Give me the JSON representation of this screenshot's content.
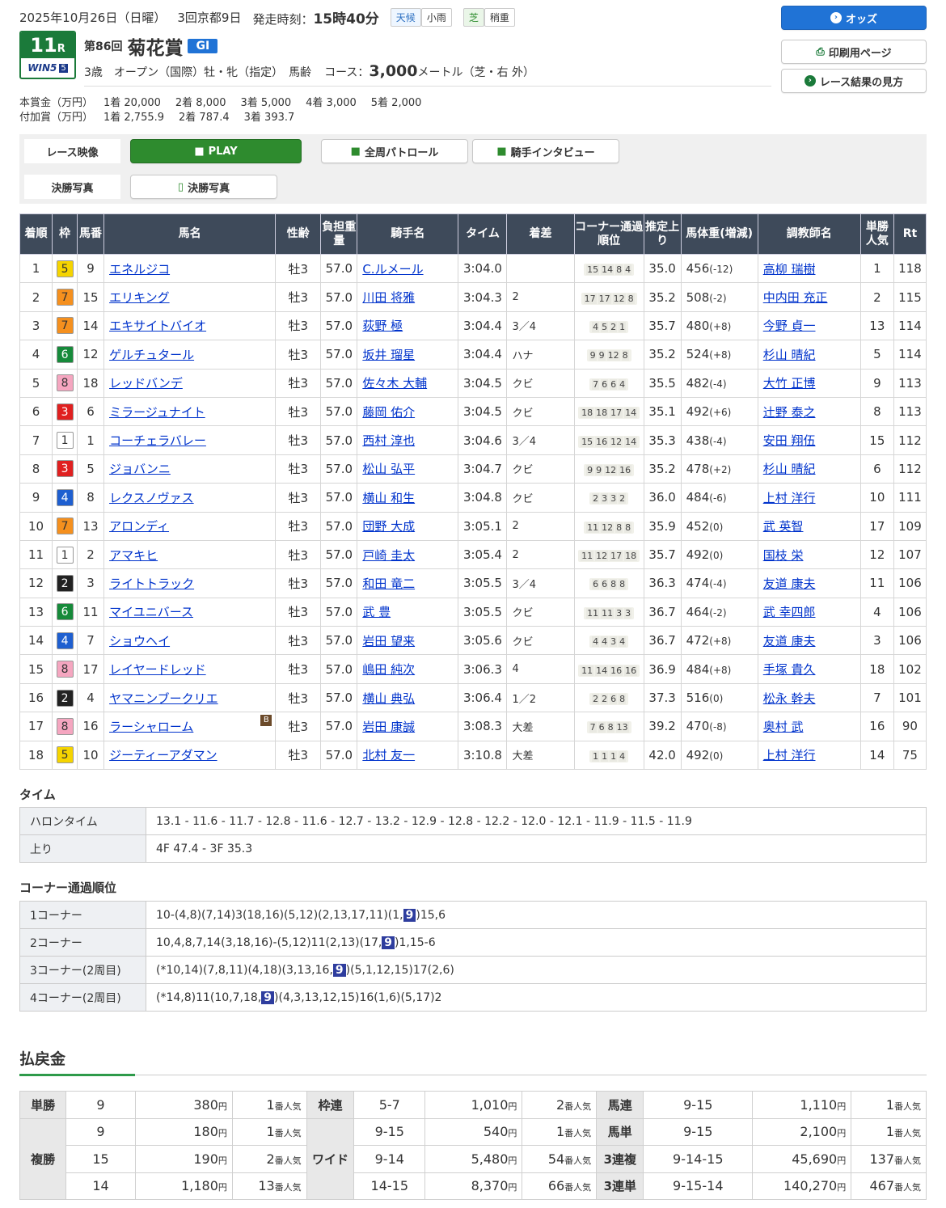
{
  "header": {
    "date": "2025年10月26日（日曜）",
    "kaisai": "3回京都9日",
    "start_label": "発走時刻：",
    "start_time": "15時40分",
    "weather_label": "天候",
    "weather": "小雨",
    "track_label": "芝",
    "track": "稍重",
    "race_no": "11",
    "race_suffix": "R",
    "win5": "WIN5",
    "win5_no": "5",
    "kai": "第86回",
    "race_name": "菊花賞",
    "grade": "GI",
    "conditions": "3歳　オープン（国際）牡・牝（指定）　馬齢",
    "course_label": "コース：",
    "distance": "3,000",
    "course_unit": "メートル（芝・右 外）",
    "prize_label": "本賞金（万円）",
    "prize": [
      "1着 20,000",
      "2着  8,000",
      "3着  5,000",
      "4着  3,000",
      "5着  2,000"
    ],
    "addprize_label": "付加賞（万円）",
    "addprize": [
      "1着 2,755.9",
      "2着  787.4",
      "3着  393.7"
    ]
  },
  "side_buttons": {
    "odds": "オッズ",
    "print": "印刷用ページ",
    "guide": "レース結果の見方"
  },
  "video": {
    "race_label": "レース映像",
    "play": "PLAY",
    "patrol": "全周パトロール",
    "interview": "騎手インタビュー",
    "photo_label": "決勝写真",
    "photo": "決勝写真"
  },
  "columns": [
    "着順",
    "枠",
    "馬番",
    "馬名",
    "性齢",
    "負担重量",
    "騎手名",
    "タイム",
    "着差",
    "コーナー通過順位",
    "推定上り",
    "馬体重(増減)",
    "調教師名",
    "単勝人気",
    "Rt"
  ],
  "waku_colors": {
    "1": [
      "#ffffff",
      "#333"
    ],
    "2": [
      "#222222",
      "#fff"
    ],
    "3": [
      "#e02020",
      "#fff"
    ],
    "4": [
      "#1e5fd0",
      "#fff"
    ],
    "5": [
      "#f5d400",
      "#333"
    ],
    "6": [
      "#168a3a",
      "#fff"
    ],
    "7": [
      "#f5901e",
      "#333"
    ],
    "8": [
      "#f5a6c0",
      "#333"
    ]
  },
  "results": [
    [
      "1",
      "5",
      "9",
      "エネルジコ",
      "牡3",
      "57.0",
      "C.ルメール",
      "3:04.0",
      "",
      [
        "15",
        "14",
        "8",
        "4"
      ],
      "35.0",
      "456",
      "(-12)",
      "高柳 瑞樹",
      "1",
      "118",
      ""
    ],
    [
      "2",
      "7",
      "15",
      "エリキング",
      "牡3",
      "57.0",
      "川田 将雅",
      "3:04.3",
      "2",
      [
        "17",
        "17",
        "12",
        "8"
      ],
      "35.2",
      "508",
      "(-2)",
      "中内田 充正",
      "2",
      "115",
      ""
    ],
    [
      "3",
      "7",
      "14",
      "エキサイトバイオ",
      "牡3",
      "57.0",
      "荻野 極",
      "3:04.4",
      "3／4",
      [
        "4",
        "5",
        "2",
        "1"
      ],
      "35.7",
      "480",
      "(+8)",
      "今野 貞一",
      "13",
      "114",
      ""
    ],
    [
      "4",
      "6",
      "12",
      "ゲルチュタール",
      "牡3",
      "57.0",
      "坂井 瑠星",
      "3:04.4",
      "ハナ",
      [
        "9",
        "9",
        "12",
        "8"
      ],
      "35.2",
      "524",
      "(+8)",
      "杉山 晴紀",
      "5",
      "114",
      ""
    ],
    [
      "5",
      "8",
      "18",
      "レッドバンデ",
      "牡3",
      "57.0",
      "佐々木 大輔",
      "3:04.5",
      "クビ",
      [
        "7",
        "6",
        "6",
        "4"
      ],
      "35.5",
      "482",
      "(-4)",
      "大竹 正博",
      "9",
      "113",
      ""
    ],
    [
      "6",
      "3",
      "6",
      "ミラージュナイト",
      "牡3",
      "57.0",
      "藤岡 佑介",
      "3:04.5",
      "クビ",
      [
        "18",
        "18",
        "17",
        "14"
      ],
      "35.1",
      "492",
      "(+6)",
      "辻野 泰之",
      "8",
      "113",
      ""
    ],
    [
      "7",
      "1",
      "1",
      "コーチェラバレー",
      "牡3",
      "57.0",
      "西村 淳也",
      "3:04.6",
      "3／4",
      [
        "15",
        "16",
        "12",
        "14"
      ],
      "35.3",
      "438",
      "(-4)",
      "安田 翔伍",
      "15",
      "112",
      ""
    ],
    [
      "8",
      "3",
      "5",
      "ジョバンニ",
      "牡3",
      "57.0",
      "松山 弘平",
      "3:04.7",
      "クビ",
      [
        "9",
        "9",
        "12",
        "16"
      ],
      "35.2",
      "478",
      "(+2)",
      "杉山 晴紀",
      "6",
      "112",
      ""
    ],
    [
      "9",
      "4",
      "8",
      "レクスノヴァス",
      "牡3",
      "57.0",
      "横山 和生",
      "3:04.8",
      "クビ",
      [
        "2",
        "3",
        "3",
        "2"
      ],
      "36.0",
      "484",
      "(-6)",
      "上村 洋行",
      "10",
      "111",
      ""
    ],
    [
      "10",
      "7",
      "13",
      "アロンディ",
      "牡3",
      "57.0",
      "団野 大成",
      "3:05.1",
      "2",
      [
        "11",
        "12",
        "8",
        "8"
      ],
      "35.9",
      "452",
      "(0)",
      "武 英智",
      "17",
      "109",
      ""
    ],
    [
      "11",
      "1",
      "2",
      "アマキヒ",
      "牡3",
      "57.0",
      "戸崎 圭太",
      "3:05.4",
      "2",
      [
        "11",
        "12",
        "17",
        "18"
      ],
      "35.7",
      "492",
      "(0)",
      "国枝 栄",
      "12",
      "107",
      ""
    ],
    [
      "12",
      "2",
      "3",
      "ライトトラック",
      "牡3",
      "57.0",
      "和田 竜二",
      "3:05.5",
      "3／4",
      [
        "6",
        "6",
        "8",
        "8"
      ],
      "36.3",
      "474",
      "(-4)",
      "友道 康夫",
      "11",
      "106",
      ""
    ],
    [
      "13",
      "6",
      "11",
      "マイユニバース",
      "牡3",
      "57.0",
      "武 豊",
      "3:05.5",
      "クビ",
      [
        "11",
        "11",
        "3",
        "3"
      ],
      "36.7",
      "464",
      "(-2)",
      "武 幸四郎",
      "4",
      "106",
      ""
    ],
    [
      "14",
      "4",
      "7",
      "ショウヘイ",
      "牡3",
      "57.0",
      "岩田 望来",
      "3:05.6",
      "クビ",
      [
        "4",
        "4",
        "3",
        "4"
      ],
      "36.7",
      "472",
      "(+8)",
      "友道 康夫",
      "3",
      "106",
      ""
    ],
    [
      "15",
      "8",
      "17",
      "レイヤードレッド",
      "牡3",
      "57.0",
      "嶋田 純次",
      "3:06.3",
      "4",
      [
        "11",
        "14",
        "16",
        "16"
      ],
      "36.9",
      "484",
      "(+8)",
      "手塚 貴久",
      "18",
      "102",
      ""
    ],
    [
      "16",
      "2",
      "4",
      "ヤマニンブークリエ",
      "牡3",
      "57.0",
      "横山 典弘",
      "3:06.4",
      "1／2",
      [
        "2",
        "2",
        "6",
        "8"
      ],
      "37.3",
      "516",
      "(0)",
      "松永 幹夫",
      "7",
      "101",
      ""
    ],
    [
      "17",
      "8",
      "16",
      "ラーシャローム",
      "牡3",
      "57.0",
      "岩田 康誠",
      "3:08.3",
      "大差",
      [
        "7",
        "6",
        "8",
        "13"
      ],
      "39.2",
      "470",
      "(-8)",
      "奥村 武",
      "16",
      "90",
      "B"
    ],
    [
      "18",
      "5",
      "10",
      "ジーティーアダマン",
      "牡3",
      "57.0",
      "北村 友一",
      "3:10.8",
      "大差",
      [
        "1",
        "1",
        "1",
        "4"
      ],
      "42.0",
      "492",
      "(0)",
      "上村 洋行",
      "14",
      "75",
      ""
    ]
  ],
  "time_section": {
    "title": "タイム",
    "halon_label": "ハロンタイム",
    "halon": "13.1 - 11.6 - 11.7 - 12.8 - 11.6 - 12.7 - 13.2 - 12.9 - 12.8 - 12.2 - 12.0 - 12.1 - 11.9 - 11.5 - 11.9",
    "agari_label": "上り",
    "agari": "4F 47.4 - 3F 35.3"
  },
  "corner_section": {
    "title": "コーナー通過順位",
    "rows": [
      {
        "label": "1コーナー",
        "pre": "10-(4,8)(7,14)3(18,16)(5,12)(2,13,17,11)(1,",
        "hl": "9",
        "post": ")15,6"
      },
      {
        "label": "2コーナー",
        "pre": "10,4,8,7,14(3,18,16)-(5,12)11(2,13)(17,",
        "hl": "9",
        "post": ")1,15-6"
      },
      {
        "label": "3コーナー(2周目)",
        "pre": "(*10,14)(7,8,11)(4,18)(3,13,16,",
        "hl": "9",
        "post": ")(5,1,12,15)17(2,6)"
      },
      {
        "label": "4コーナー(2周目)",
        "pre": "(*14,8)11(10,7,18,",
        "hl": "9",
        "post": ")(4,3,13,12,15)16(1,6)(5,17)2"
      }
    ]
  },
  "payout": {
    "title": "払戻金",
    "yen": "円",
    "pop": "番人気",
    "tansho": {
      "label": "単勝",
      "rows": [
        [
          "9",
          "380",
          "1"
        ]
      ]
    },
    "fukusho": {
      "label": "複勝",
      "rows": [
        [
          "9",
          "180",
          "1"
        ],
        [
          "15",
          "190",
          "2"
        ],
        [
          "14",
          "1,180",
          "13"
        ]
      ]
    },
    "wakuren": {
      "label": "枠連",
      "rows": [
        [
          "5-7",
          "1,010",
          "2"
        ]
      ]
    },
    "wide": {
      "label": "ワイド",
      "rows": [
        [
          "9-15",
          "540",
          "1"
        ],
        [
          "9-14",
          "5,480",
          "54"
        ],
        [
          "14-15",
          "8,370",
          "66"
        ]
      ]
    },
    "umaren": {
      "label": "馬連",
      "rows": [
        [
          "9-15",
          "1,110",
          "1"
        ]
      ]
    },
    "umatan": {
      "label": "馬単",
      "rows": [
        [
          "9-15",
          "2,100",
          "1"
        ]
      ]
    },
    "sanrenpuku": {
      "label": "3連複",
      "rows": [
        [
          "9-14-15",
          "45,690",
          "137"
        ]
      ]
    },
    "sanrentan": {
      "label": "3連単",
      "rows": [
        [
          "9-15-14",
          "140,270",
          "467"
        ]
      ]
    }
  }
}
